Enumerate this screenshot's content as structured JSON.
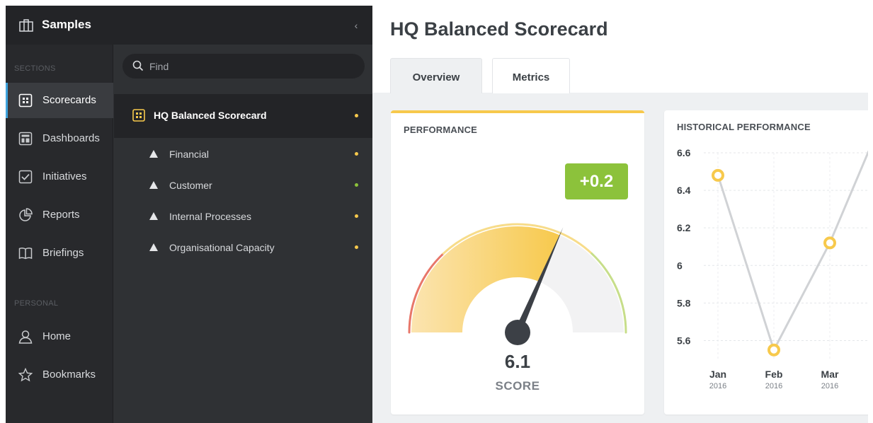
{
  "app": {
    "title": "Samples",
    "collapse_glyph": "‹"
  },
  "sections": {
    "label": "SECTIONS",
    "items": [
      {
        "label": "Scorecards",
        "icon": "scorecard-icon",
        "active": true
      },
      {
        "label": "Dashboards",
        "icon": "dashboard-icon"
      },
      {
        "label": "Initiatives",
        "icon": "checkbox-icon"
      },
      {
        "label": "Reports",
        "icon": "pie-chart-icon"
      },
      {
        "label": "Briefings",
        "icon": "book-icon"
      }
    ],
    "personal_label": "PERSONAL",
    "personal_items": [
      {
        "label": "Home",
        "icon": "user-icon"
      },
      {
        "label": "Bookmarks",
        "icon": "star-icon"
      }
    ]
  },
  "search": {
    "placeholder": "Find"
  },
  "tree": {
    "root": {
      "label": "HQ Balanced Scorecard",
      "status_color": "#f7c94c"
    },
    "children": [
      {
        "label": "Financial",
        "status_color": "#f7c94c"
      },
      {
        "label": "Customer",
        "status_color": "#8cc23b"
      },
      {
        "label": "Internal Processes",
        "status_color": "#f7c94c"
      },
      {
        "label": "Organisational Capacity",
        "status_color": "#f7c94c"
      }
    ]
  },
  "page": {
    "title": "HQ Balanced Scorecard",
    "tabs": [
      {
        "label": "Overview",
        "active": true
      },
      {
        "label": "Metrics",
        "active": false
      }
    ]
  },
  "performance": {
    "title": "PERFORMANCE",
    "delta": "+0.2",
    "score": "6.1",
    "score_label": "SCORE",
    "gauge_fraction": 0.63,
    "colors": {
      "red": "#e8776a",
      "yellow": "#f7c94c",
      "green": "#8cc23b"
    }
  },
  "history": {
    "title": "HISTORICAL PERFORMANCE"
  },
  "chart_data": {
    "type": "line",
    "title": "HISTORICAL PERFORMANCE",
    "categories": [
      "Jan",
      "Feb",
      "Mar"
    ],
    "category_sublabels": [
      "2016",
      "2016",
      "2016"
    ],
    "yticks": [
      "6.6",
      "6.4",
      "6.2",
      "6",
      "5.8",
      "5.6"
    ],
    "ylim": [
      5.5,
      6.6
    ],
    "series": [
      {
        "values": [
          6.48,
          5.55,
          6.12
        ]
      }
    ],
    "grid": true,
    "colors": {
      "line": "#d0d2d5",
      "marker": "#f7c94c"
    }
  }
}
